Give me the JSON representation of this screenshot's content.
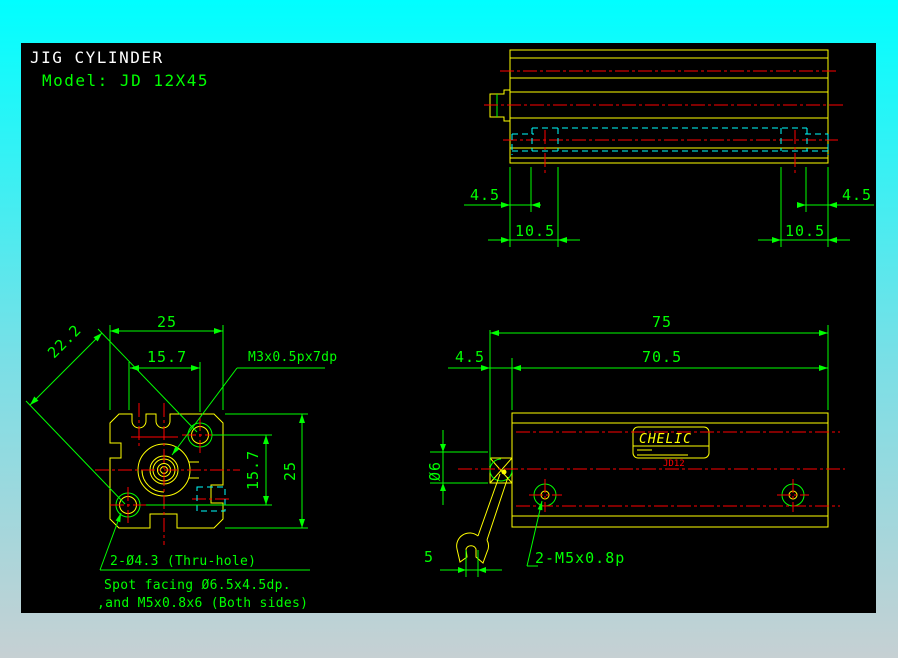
{
  "title_block": {
    "name": "JIG CYLINDER",
    "model": "Model: JD 12X45"
  },
  "colors": {
    "background_top": "#00ffff",
    "background_bottom": "#c6d0d3",
    "canvas": "#000000",
    "outline": "#ffff00",
    "dimension": "#00ff00",
    "centerline": "#ff0000",
    "hidden": "#00ffff",
    "title_text": "#ffffff"
  },
  "front_view": {
    "dim_width_top": "25",
    "dim_hole_spacing_top": "15.7",
    "dim_diagonal": "22.2",
    "dim_hole_spacing_right": "15.7",
    "dim_height_right": "25",
    "label_port_thread": "M3x0.5px7dp",
    "label_thru_hole": "2-Ø4.3 (Thru-hole)",
    "note_line1": "Spot facing Ø6.5x4.5dp.",
    "note_line2": ",and M5x0.8x6 (Both sides)"
  },
  "side_view": {
    "dim_left_offset": "4.5",
    "dim_left_pitch": "10.5",
    "dim_right_offset": "4.5",
    "dim_right_pitch": "10.5"
  },
  "top_view": {
    "dim_total_length": "75",
    "dim_body_length": "70.5",
    "dim_rod_extension": "4.5",
    "dim_rod_diameter": "Ø6",
    "dim_wrench_flats": "5",
    "label_mount_thread": "2-M5x0.8p",
    "brand": "CHELIC",
    "brand_mark": "JD12"
  }
}
